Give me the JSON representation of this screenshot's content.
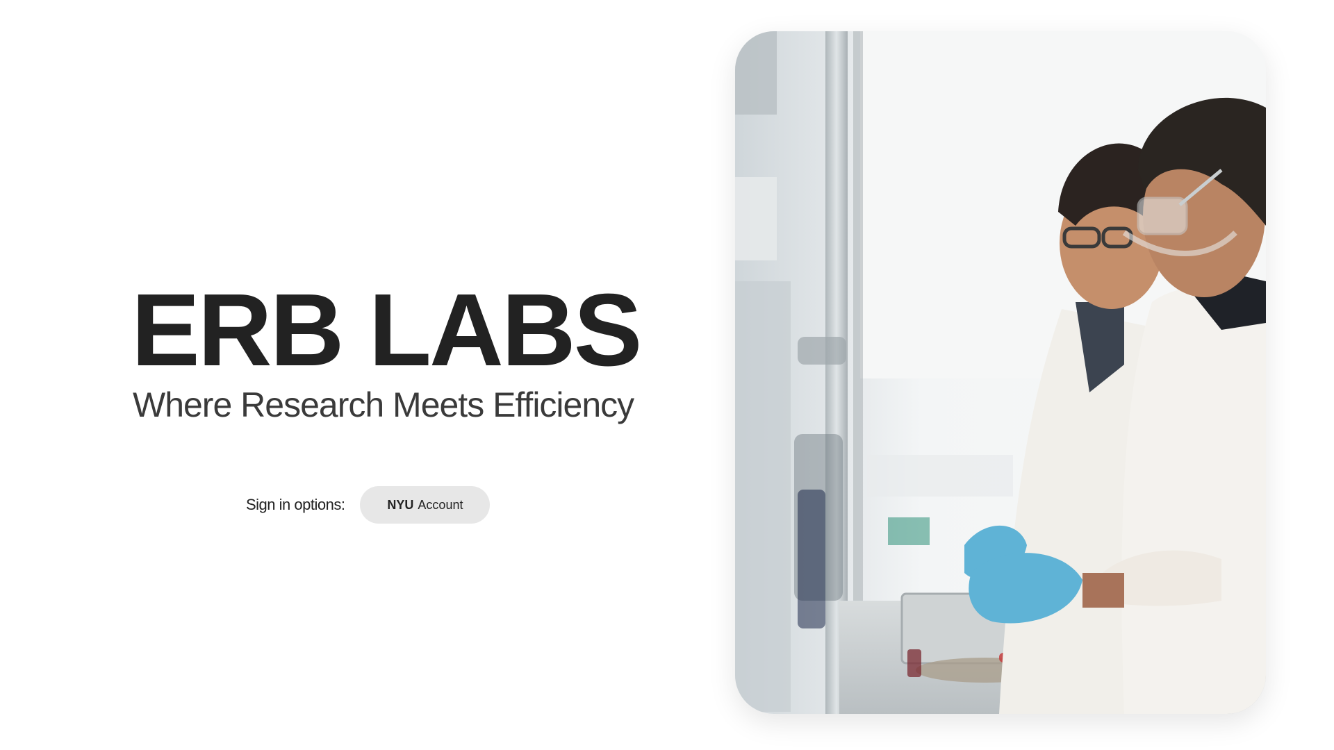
{
  "brand": {
    "title": "ERB LABS",
    "tagline": "Where Research Meets Efficiency"
  },
  "signin": {
    "label": "Sign in options:",
    "nyu_button": {
      "brand": "NYU",
      "text": "Account"
    }
  },
  "hero_image": {
    "subject": "two researchers in lab coats working at a lab bench"
  },
  "colors": {
    "title": "#222222",
    "tagline": "#3a3a3a",
    "button_bg": "#e7e7e7",
    "glove": "#5fb3d6",
    "coat": "#f4f2ee"
  }
}
